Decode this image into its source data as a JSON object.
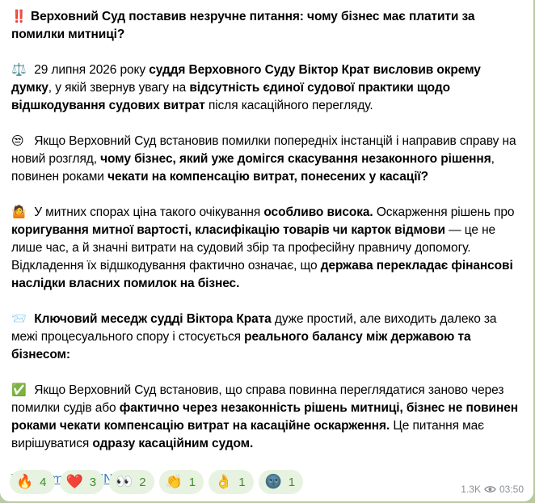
{
  "message": {
    "title": {
      "emoji": "‼️",
      "text": "Верховний Суд поставив незручне питання: чому бізнес має платити за помилки митниці?"
    },
    "p1": {
      "emoji": "⚖️",
      "t1": " 29 липня 2026 року ",
      "b1": "суддя Верховного Суду Віктор Крат висловив окрему думку",
      "t2": ", у якій звернув увагу на ",
      "b2": "відсутність єдиної судової практики щодо відшкодування судових витрат",
      "t3": " після касаційного перегляду."
    },
    "p2": {
      "emoji": "😒",
      "t1": " Якщо Верховний Суд встановив помилки попередніх інстанцій і направив справу на новий розгляд, ",
      "b1": "чому бізнес, який уже домігся скасування незаконного рішення",
      "t2": ", повинен роками ",
      "b2": "чекати на компенсацію витрат, понесених у касації?"
    },
    "p3": {
      "emoji": "🤷",
      "t1": " У митних спорах ціна такого очікування ",
      "b1": "особливо висока.",
      "t2": " Оскарження рішень про ",
      "b2": "коригування митної вартості, класифікацію товарів чи карток відмови",
      "t3": " — це не лише час, а й значні витрати на судовий збір та професійну правничу допомогу. Відкладення їх відшкодування фактично означає, що ",
      "b3": "держава перекладає фінансові наслідки власних помилок на бізнес."
    },
    "p4": {
      "emoji": "📨",
      "b1": " Ключовий меседж судді Віктора Крата",
      "t1": " дуже простий, але виходить далеко за межі процесуального спору і стосується ",
      "b2": "реального балансу між державою та бізнесом:"
    },
    "p5": {
      "emoji": "✅",
      "t1": " Якщо Верховний Суд встановив, що справа повинна переглядатися заново через помилки судів або ",
      "b1": "фактично через незаконність рішень митниці, бізнес не повинен роками чекати компенсацію витрат на касаційне оскарження.",
      "t2": " Це питання має вирішуватися ",
      "b2": "одразу касаційним судом."
    }
  },
  "links": {
    "telegram": "Telegram",
    "separator": " | ",
    "admin": "ADMIN"
  },
  "reactions": [
    {
      "emoji": "🔥",
      "count": "4"
    },
    {
      "emoji": "❤️",
      "count": "3"
    },
    {
      "emoji": "👀",
      "count": "2"
    },
    {
      "emoji": "👏",
      "count": "1"
    },
    {
      "emoji": "👌",
      "count": "1"
    },
    {
      "emoji": "🌚",
      "count": "1"
    }
  ],
  "meta": {
    "views": "1.3K",
    "time": "03:50"
  },
  "colors": {
    "accent": "#2a7bbf",
    "reaction_bg": "#e8f2e0",
    "reaction_text": "#3d8d2e"
  }
}
